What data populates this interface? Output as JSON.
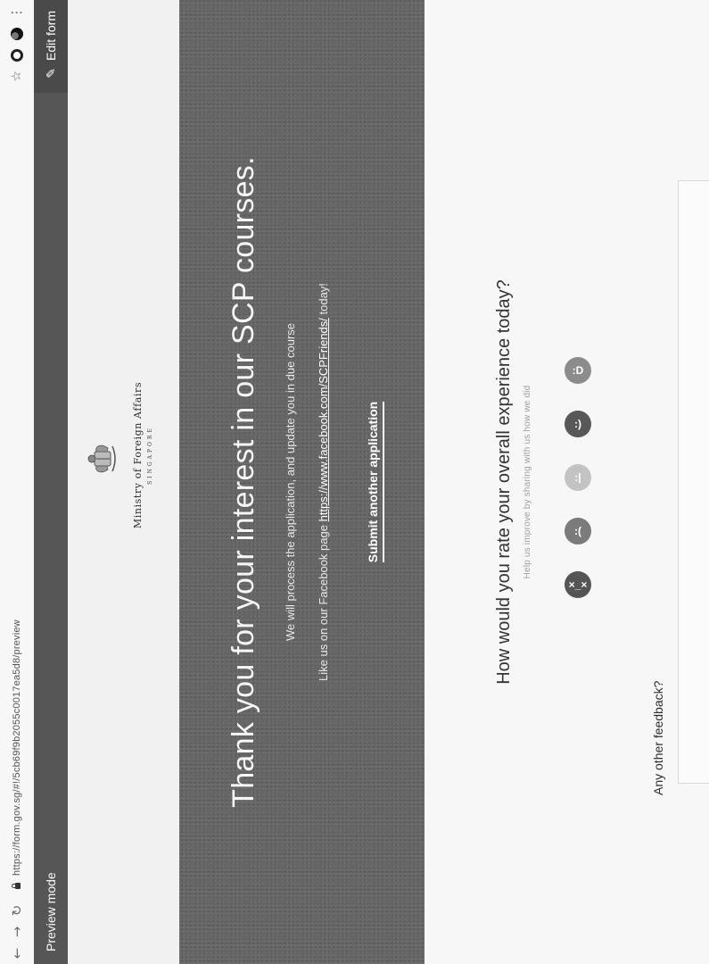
{
  "browser": {
    "url": "https://form.gov.sg/#!/5cb69f9b2055c0017ea5d8/preview"
  },
  "preview_bar": {
    "mode_label": "Preview mode",
    "edit_label": "Edit form"
  },
  "logo": {
    "ministry": "Ministry of Foreign Affairs",
    "country": "SINGAPORE"
  },
  "hero": {
    "title": "Thank you for your interest in our SCP courses.",
    "line1": "We will process the application, and update you in due course",
    "line2_prefix": "Like us on our Facebook page ",
    "line2_link": "https://www.facebook.com/SCPFriends/",
    "line2_suffix": " today!",
    "submit_label": "Submit another application"
  },
  "feedback": {
    "question": "How would you rate your overall experience today?",
    "subtitle": "Help us improve by sharing with us how we did",
    "faces": [
      {
        "icon": "very-dissatisfied-face-icon",
        "glyph": "×_×"
      },
      {
        "icon": "dissatisfied-face-icon",
        "glyph": ":("
      },
      {
        "icon": "neutral-face-icon",
        "glyph": ":|"
      },
      {
        "icon": "satisfied-face-icon",
        "glyph": ":)"
      },
      {
        "icon": "very-satisfied-face-icon",
        "glyph": ":D"
      }
    ],
    "other_label": "Any other feedback?"
  }
}
